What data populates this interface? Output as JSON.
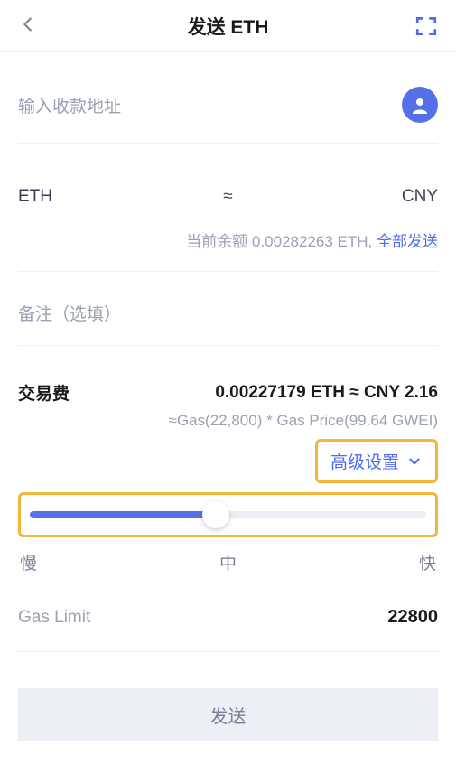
{
  "header": {
    "title": "发送 ETH"
  },
  "address": {
    "placeholder": "输入收款地址"
  },
  "amount": {
    "token": "ETH",
    "symbol": "≈",
    "fiat": "CNY"
  },
  "balance": {
    "text": "当前余额 0.00282263 ETH,",
    "send_all": "全部发送"
  },
  "memo": {
    "placeholder": "备注（选填）"
  },
  "fee": {
    "label": "交易费",
    "value": "0.00227179 ETH ≈ CNY 2.16",
    "formula": "≈Gas(22,800) * Gas Price(99.64 GWEI)"
  },
  "advanced": {
    "label": "高级设置"
  },
  "slider": {
    "slow": "慢",
    "mid": "中",
    "fast": "快"
  },
  "gas_limit": {
    "label": "Gas Limit",
    "value": "22800"
  },
  "send_button": {
    "label": "发送"
  }
}
